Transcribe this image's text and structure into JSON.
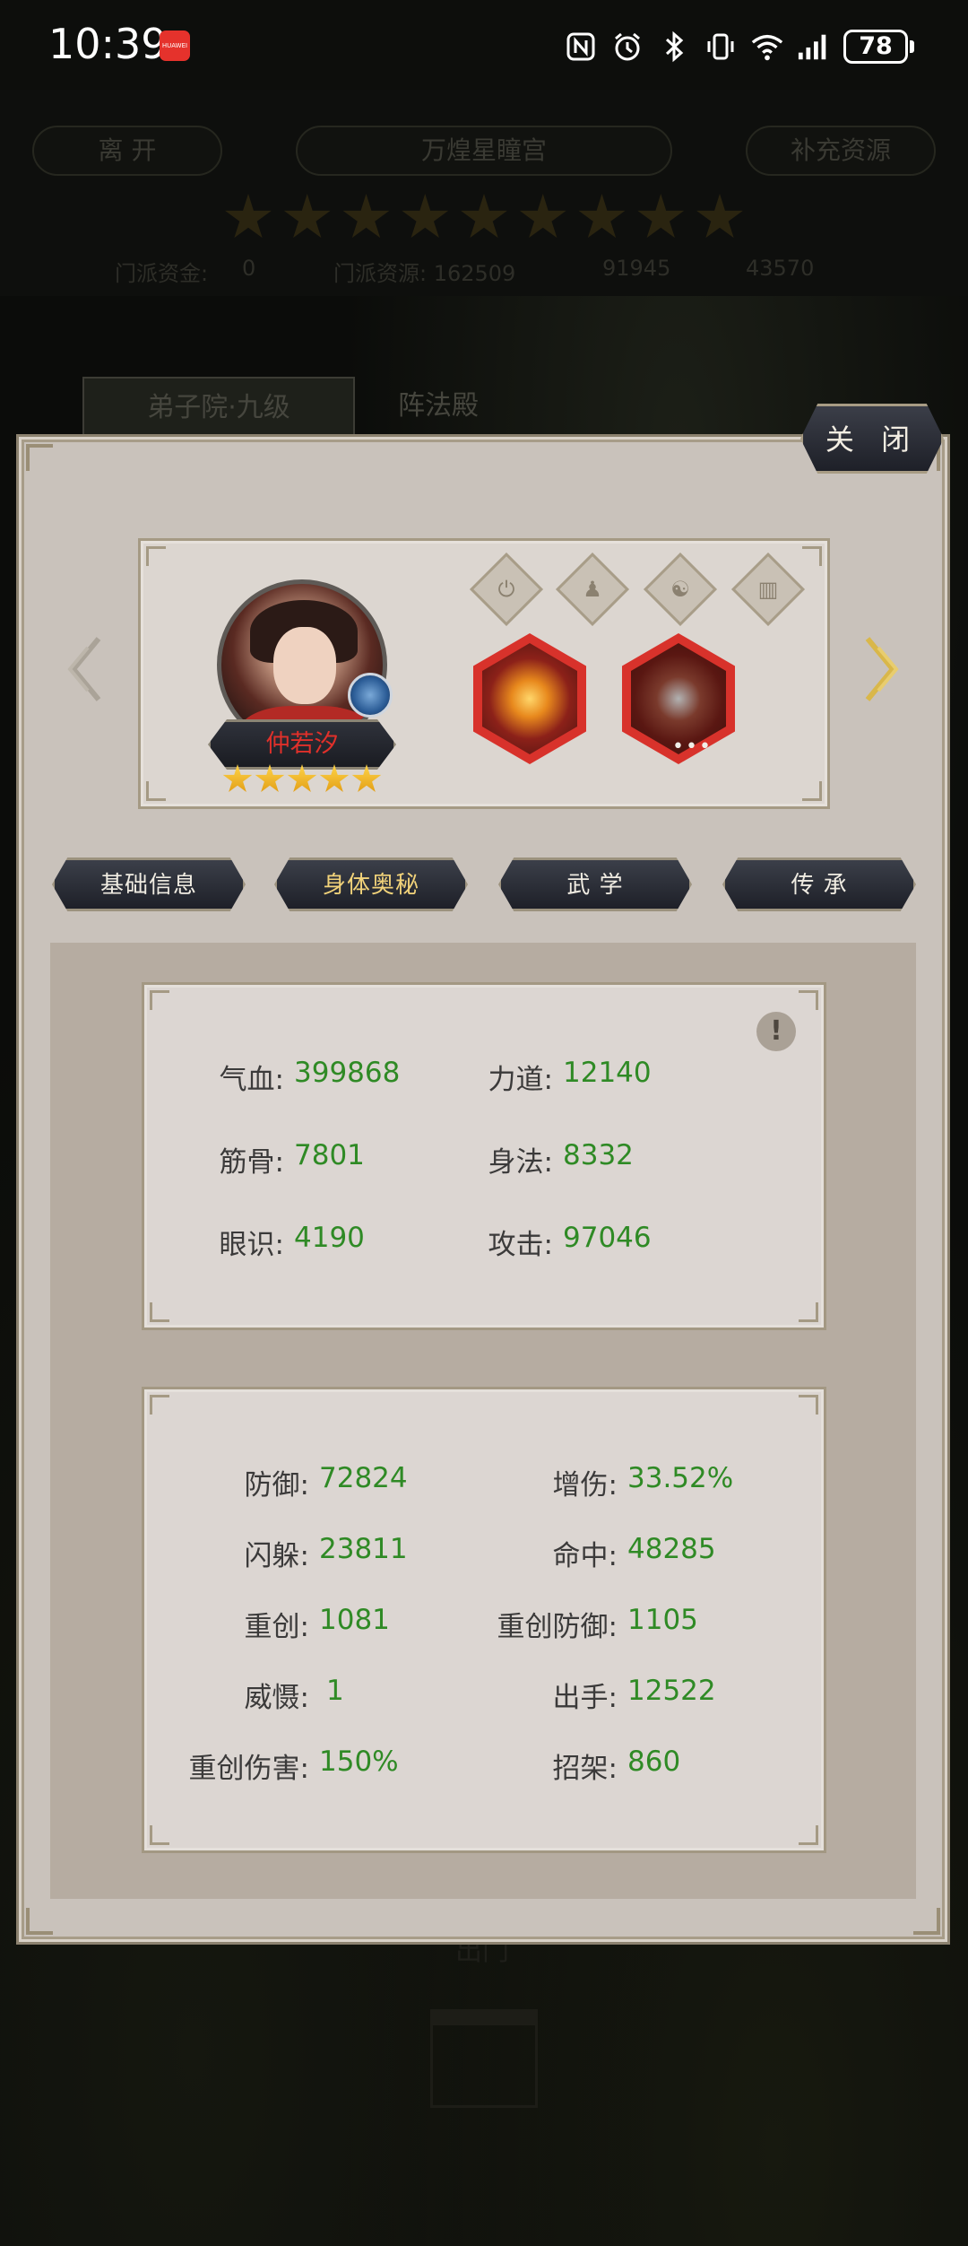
{
  "status_bar": {
    "time": "10:39",
    "app_badge": "HUAWEI",
    "battery": "78"
  },
  "background": {
    "leave_button": "离 开",
    "sect_name": "万煌星瞳宫",
    "supplement_button": "补充资源",
    "resources": [
      "门派资金:",
      "0",
      "门派资源: 162509",
      "91945",
      "43570"
    ],
    "tab_disciple": "弟子院·九级",
    "tab_formation": "阵法殿",
    "exit_label": "出门"
  },
  "modal": {
    "close_label": "关 闭",
    "hero": {
      "name": "仲若汐",
      "star_count": 5
    },
    "tabs": [
      {
        "label": "基础信息",
        "active": false
      },
      {
        "label": "身体奥秘",
        "active": true
      },
      {
        "label": "武 学",
        "active": false
      },
      {
        "label": "传 承",
        "active": false
      }
    ],
    "info_icon": "!",
    "hex_more": "•••",
    "basic_stats": [
      {
        "label": "气血:",
        "value": "399868"
      },
      {
        "label": "力道:",
        "value": "12140"
      },
      {
        "label": "筋骨:",
        "value": "7801"
      },
      {
        "label": "身法:",
        "value": "8332"
      },
      {
        "label": "眼识:",
        "value": "4190"
      },
      {
        "label": "攻击:",
        "value": "97046"
      }
    ],
    "combat_stats": [
      {
        "label": "防御:",
        "value": "72824"
      },
      {
        "label": "增伤:",
        "value": "33.52%"
      },
      {
        "label": "闪躲:",
        "value": "23811"
      },
      {
        "label": "命中:",
        "value": "48285"
      },
      {
        "label": "重创:",
        "value": "1081"
      },
      {
        "label": "重创防御:",
        "value": "1105"
      },
      {
        "label": "威慑:",
        "value": "1"
      },
      {
        "label": "出手:",
        "value": "12522"
      },
      {
        "label": "重创伤害:",
        "value": "150%"
      },
      {
        "label": "招架:",
        "value": "860"
      }
    ]
  },
  "colors": {
    "stat_value": "#2f8a25",
    "active_tab": "#f2d37a",
    "hero_name": "#e0302a"
  }
}
